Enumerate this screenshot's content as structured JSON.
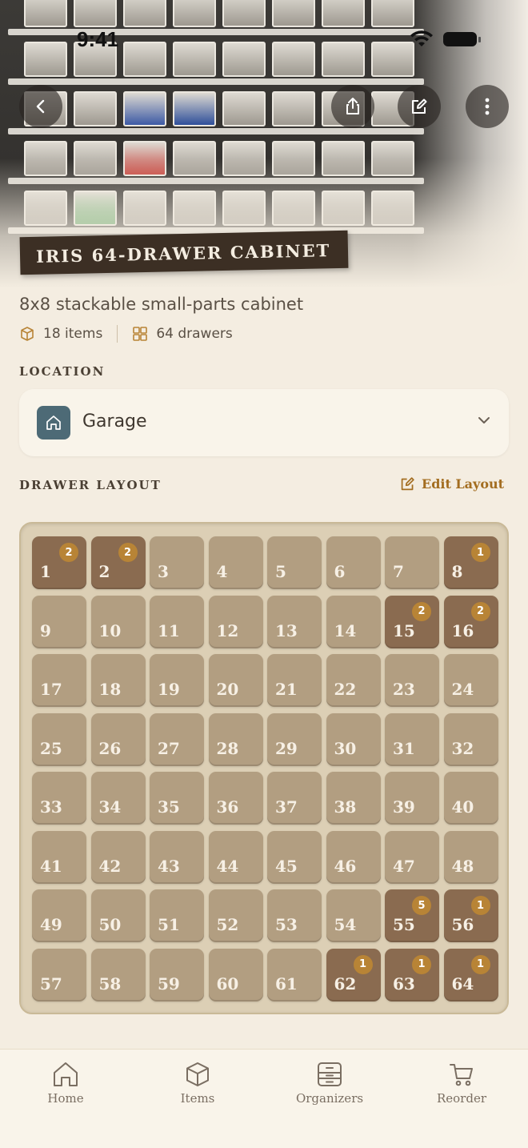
{
  "status_bar": {
    "time": "9:41"
  },
  "header": {
    "title": "IRIS 64-DRAWER CABINET",
    "subtitle": "8x8 stackable small-parts cabinet",
    "items_count": "18 items",
    "drawers_count": "64 drawers"
  },
  "location": {
    "section_label": "LOCATION",
    "selected": "Garage"
  },
  "drawer_layout": {
    "section_label": "DRAWER LAYOUT",
    "edit_label": "Edit Layout",
    "columns": 8,
    "rows": 8,
    "drawers": [
      {
        "number": "1",
        "count": "2"
      },
      {
        "number": "2",
        "count": "2"
      },
      {
        "number": "3",
        "count": ""
      },
      {
        "number": "4",
        "count": ""
      },
      {
        "number": "5",
        "count": ""
      },
      {
        "number": "6",
        "count": ""
      },
      {
        "number": "7",
        "count": ""
      },
      {
        "number": "8",
        "count": "1"
      },
      {
        "number": "9",
        "count": ""
      },
      {
        "number": "10",
        "count": ""
      },
      {
        "number": "11",
        "count": ""
      },
      {
        "number": "12",
        "count": ""
      },
      {
        "number": "13",
        "count": ""
      },
      {
        "number": "14",
        "count": ""
      },
      {
        "number": "15",
        "count": "2"
      },
      {
        "number": "16",
        "count": "2"
      },
      {
        "number": "17",
        "count": ""
      },
      {
        "number": "18",
        "count": ""
      },
      {
        "number": "19",
        "count": ""
      },
      {
        "number": "20",
        "count": ""
      },
      {
        "number": "21",
        "count": ""
      },
      {
        "number": "22",
        "count": ""
      },
      {
        "number": "23",
        "count": ""
      },
      {
        "number": "24",
        "count": ""
      },
      {
        "number": "25",
        "count": ""
      },
      {
        "number": "26",
        "count": ""
      },
      {
        "number": "27",
        "count": ""
      },
      {
        "number": "28",
        "count": ""
      },
      {
        "number": "29",
        "count": ""
      },
      {
        "number": "30",
        "count": ""
      },
      {
        "number": "31",
        "count": ""
      },
      {
        "number": "32",
        "count": ""
      },
      {
        "number": "33",
        "count": ""
      },
      {
        "number": "34",
        "count": ""
      },
      {
        "number": "35",
        "count": ""
      },
      {
        "number": "36",
        "count": ""
      },
      {
        "number": "37",
        "count": ""
      },
      {
        "number": "38",
        "count": ""
      },
      {
        "number": "39",
        "count": ""
      },
      {
        "number": "40",
        "count": ""
      },
      {
        "number": "41",
        "count": ""
      },
      {
        "number": "42",
        "count": ""
      },
      {
        "number": "43",
        "count": ""
      },
      {
        "number": "44",
        "count": ""
      },
      {
        "number": "45",
        "count": ""
      },
      {
        "number": "46",
        "count": ""
      },
      {
        "number": "47",
        "count": ""
      },
      {
        "number": "48",
        "count": ""
      },
      {
        "number": "49",
        "count": ""
      },
      {
        "number": "50",
        "count": ""
      },
      {
        "number": "51",
        "count": ""
      },
      {
        "number": "52",
        "count": ""
      },
      {
        "number": "53",
        "count": ""
      },
      {
        "number": "54",
        "count": ""
      },
      {
        "number": "55",
        "count": "5"
      },
      {
        "number": "56",
        "count": "1"
      },
      {
        "number": "57",
        "count": ""
      },
      {
        "number": "58",
        "count": ""
      },
      {
        "number": "59",
        "count": ""
      },
      {
        "number": "60",
        "count": ""
      },
      {
        "number": "61",
        "count": ""
      },
      {
        "number": "62",
        "count": "1"
      },
      {
        "number": "63",
        "count": "1"
      },
      {
        "number": "64",
        "count": "1"
      }
    ]
  },
  "tab_bar": {
    "home": "Home",
    "items": "Items",
    "organizers": "Organizers",
    "reorder": "Reorder"
  },
  "colors": {
    "background": "#f4ede1",
    "accent": "#a36d20",
    "drawer_empty": "#b29e81",
    "drawer_filled": "#8a6b50",
    "badge": "#b88436",
    "location_icon": "#4d6a76"
  }
}
